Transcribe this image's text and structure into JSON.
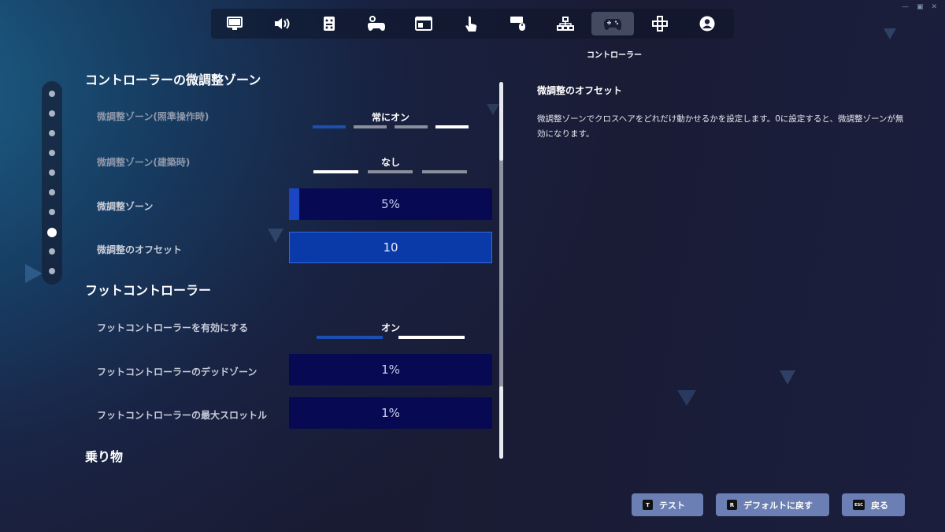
{
  "nav": {
    "tabs": [
      {
        "icon": "monitor-icon"
      },
      {
        "icon": "speaker-icon"
      },
      {
        "icon": "controller-layout-icon"
      },
      {
        "icon": "gamepad-settings-icon"
      },
      {
        "icon": "window-icon"
      },
      {
        "icon": "touch-icon"
      },
      {
        "icon": "keyboard-mouse-icon"
      },
      {
        "icon": "network-icon"
      },
      {
        "icon": "gamepad-icon"
      },
      {
        "icon": "dpad-icon"
      },
      {
        "icon": "account-icon"
      }
    ],
    "active_index": 8,
    "active_label": "コントローラー"
  },
  "dots": {
    "count": 10,
    "active_index": 7
  },
  "section1": {
    "title": "コントローラーの微調整ゾーン",
    "rows": {
      "aim_label": "微調整ゾーン(照準操作時)",
      "aim_value": "常にオン",
      "build_label": "微調整ゾーン(建築時)",
      "build_value": "なし",
      "zone_label": "微調整ゾーン",
      "zone_value": "5%",
      "zone_fraction": 0.05,
      "offset_label": "微調整のオフセット",
      "offset_value": "10"
    }
  },
  "section2": {
    "title": "フットコントローラー",
    "rows": {
      "enable_label": "フットコントローラーを有効にする",
      "enable_value": "オン",
      "deadzone_label": "フットコントローラーのデッドゾーン",
      "deadzone_value": "1%",
      "throttle_label": "フットコントローラーの最大スロットル",
      "throttle_value": "1%"
    }
  },
  "section3": {
    "title": "乗り物"
  },
  "description": {
    "title": "微調整のオフセット",
    "body": "微調整ゾーンでクロスヘアをどれだけ動かせるかを設定します。0に設定すると、微調整ゾーンが無効になります。"
  },
  "footer": {
    "test": {
      "key": "T",
      "label": "テスト"
    },
    "reset": {
      "key": "R",
      "label": "デフォルトに戻す"
    },
    "back": {
      "key": "ESC",
      "label": "戻る"
    }
  },
  "colors": {
    "accent": "#1d4fb0",
    "slider_bg": "#070a52",
    "button": "#6c7fb4"
  }
}
